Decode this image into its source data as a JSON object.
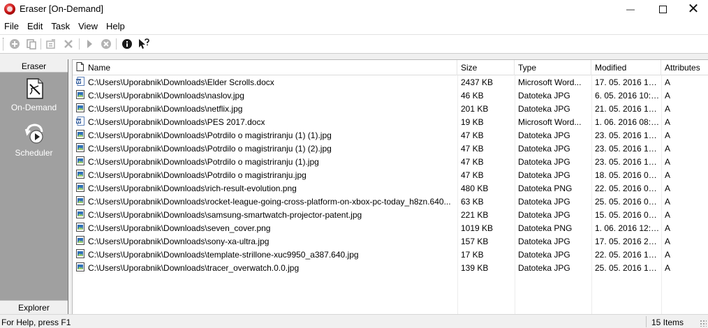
{
  "window": {
    "title": "Eraser  [On-Demand]",
    "minimize_glyph": "—",
    "close_glyph": "✕"
  },
  "menu": [
    "File",
    "Edit",
    "Task",
    "View",
    "Help"
  ],
  "toolbar": {
    "icons": [
      "add-task-icon",
      "paste-icon",
      "properties-icon",
      "delete-icon",
      "run-icon",
      "stop-icon",
      "about-icon",
      "whats-this-icon"
    ]
  },
  "sidebar": {
    "header": "Eraser",
    "items": [
      {
        "label": "On-Demand",
        "icon": "on-demand-icon",
        "selected": true
      },
      {
        "label": "Scheduler",
        "icon": "scheduler-icon",
        "selected": false
      }
    ],
    "footer": "Explorer"
  },
  "list": {
    "columns": [
      "Name",
      "Size",
      "Type",
      "Modified",
      "Attributes"
    ],
    "rows": [
      {
        "name": "C:\\Users\\Uporabnik\\Downloads\\Elder Scrolls.docx",
        "size": "2437 KB",
        "type": "Microsoft Word...",
        "modified": "17. 05. 2016 10:...",
        "attr": "A",
        "icon": "word-icon"
      },
      {
        "name": "C:\\Users\\Uporabnik\\Downloads\\naslov.jpg",
        "size": "46 KB",
        "type": "Datoteka JPG",
        "modified": "6. 05. 2016 10:2...",
        "attr": "A",
        "icon": "image-icon"
      },
      {
        "name": "C:\\Users\\Uporabnik\\Downloads\\netflix.jpg",
        "size": "201 KB",
        "type": "Datoteka JPG",
        "modified": "21. 05. 2016 10:...",
        "attr": "A",
        "icon": "image-icon"
      },
      {
        "name": "C:\\Users\\Uporabnik\\Downloads\\PES 2017.docx",
        "size": "19 KB",
        "type": "Microsoft Word...",
        "modified": "1. 06. 2016 08:2...",
        "attr": "A",
        "icon": "word-icon"
      },
      {
        "name": "C:\\Users\\Uporabnik\\Downloads\\Potrdilo o magistriranju (1) (1).jpg",
        "size": "47 KB",
        "type": "Datoteka JPG",
        "modified": "23. 05. 2016 10:...",
        "attr": "A",
        "icon": "image-icon"
      },
      {
        "name": "C:\\Users\\Uporabnik\\Downloads\\Potrdilo o magistriranju (1) (2).jpg",
        "size": "47 KB",
        "type": "Datoteka JPG",
        "modified": "23. 05. 2016 10:...",
        "attr": "A",
        "icon": "image-icon"
      },
      {
        "name": "C:\\Users\\Uporabnik\\Downloads\\Potrdilo o magistriranju (1).jpg",
        "size": "47 KB",
        "type": "Datoteka JPG",
        "modified": "23. 05. 2016 10:...",
        "attr": "A",
        "icon": "image-icon"
      },
      {
        "name": "C:\\Users\\Uporabnik\\Downloads\\Potrdilo o magistriranju.jpg",
        "size": "47 KB",
        "type": "Datoteka JPG",
        "modified": "18. 05. 2016 09:...",
        "attr": "A",
        "icon": "image-icon"
      },
      {
        "name": "C:\\Users\\Uporabnik\\Downloads\\rich-result-evolution.png",
        "size": "480 KB",
        "type": "Datoteka PNG",
        "modified": "22. 05. 2016 09:...",
        "attr": "A",
        "icon": "image-icon"
      },
      {
        "name": "C:\\Users\\Uporabnik\\Downloads\\rocket-league-going-cross-platform-on-xbox-pc-today_h8zn.640...",
        "size": "63 KB",
        "type": "Datoteka JPG",
        "modified": "25. 05. 2016 08:...",
        "attr": "A",
        "icon": "image-icon"
      },
      {
        "name": "C:\\Users\\Uporabnik\\Downloads\\samsung-smartwatch-projector-patent.jpg",
        "size": "221 KB",
        "type": "Datoteka JPG",
        "modified": "15. 05. 2016 09:...",
        "attr": "A",
        "icon": "image-icon"
      },
      {
        "name": "C:\\Users\\Uporabnik\\Downloads\\seven_cover.png",
        "size": "1019 KB",
        "type": "Datoteka PNG",
        "modified": "1. 06. 2016 12:5...",
        "attr": "A",
        "icon": "image-icon"
      },
      {
        "name": "C:\\Users\\Uporabnik\\Downloads\\sony-xa-ultra.jpg",
        "size": "157 KB",
        "type": "Datoteka JPG",
        "modified": "17. 05. 2016 20:...",
        "attr": "A",
        "icon": "image-icon"
      },
      {
        "name": "C:\\Users\\Uporabnik\\Downloads\\template-strillone-xuc9950_a387.640.jpg",
        "size": "17 KB",
        "type": "Datoteka JPG",
        "modified": "22. 05. 2016 15:...",
        "attr": "A",
        "icon": "image-icon"
      },
      {
        "name": "C:\\Users\\Uporabnik\\Downloads\\tracer_overwatch.0.0.jpg",
        "size": "139 KB",
        "type": "Datoteka JPG",
        "modified": "25. 05. 2016 12:...",
        "attr": "A",
        "icon": "image-icon"
      }
    ]
  },
  "status": {
    "help": "For Help, press F1",
    "count": "15 Items"
  },
  "colors": {
    "sidebar_bg": "#a0a0a0",
    "chrome_bg": "#f0f0f0",
    "word_blue": "#2b579a",
    "image_blue": "#2f6fb8"
  }
}
